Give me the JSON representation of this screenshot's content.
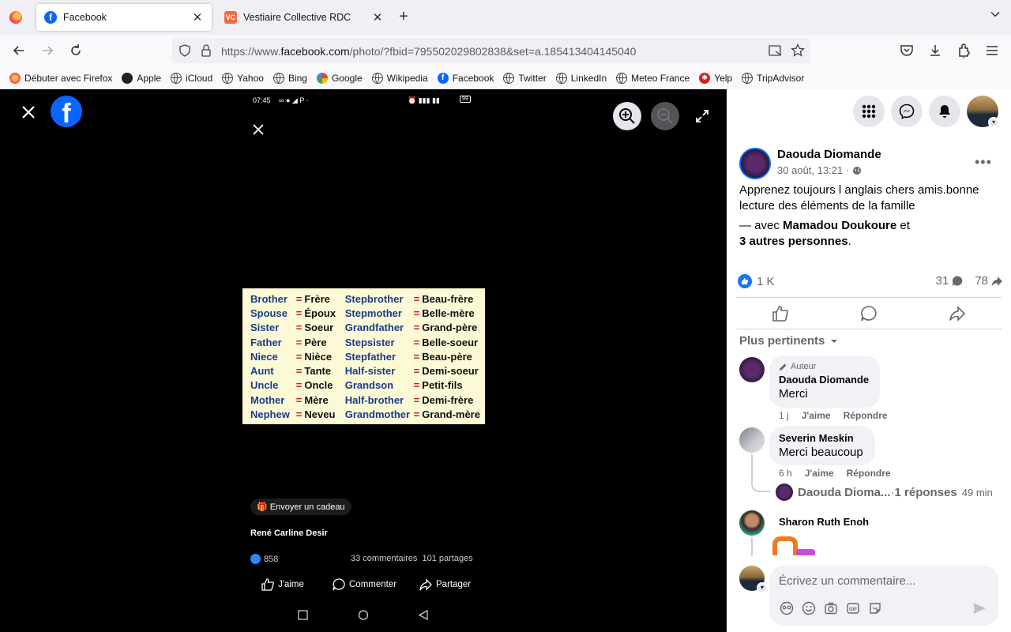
{
  "browser": {
    "tabs": [
      {
        "title": "Facebook",
        "active": true,
        "icon": "facebook-icon"
      },
      {
        "title": "Vestiaire Collective RDC",
        "active": false,
        "icon": "vestiaire-icon"
      }
    ],
    "url_prefix": "https://www.",
    "url_domain": "facebook.com",
    "url_rest": "/photo/?fbid=795502029802838&set=a.185413404145040",
    "bookmarks": [
      {
        "label": "Débuter avec Firefox",
        "icon": "firefox-icon"
      },
      {
        "label": "Apple",
        "icon": "apple-icon"
      },
      {
        "label": "iCloud",
        "icon": "globe-icon"
      },
      {
        "label": "Yahoo",
        "icon": "globe-icon"
      },
      {
        "label": "Bing",
        "icon": "globe-icon"
      },
      {
        "label": "Google",
        "icon": "google-icon"
      },
      {
        "label": "Wikipedia",
        "icon": "globe-icon"
      },
      {
        "label": "Facebook",
        "icon": "facebook-icon"
      },
      {
        "label": "Twitter",
        "icon": "globe-icon"
      },
      {
        "label": "LinkedIn",
        "icon": "globe-icon"
      },
      {
        "label": "Meteo France",
        "icon": "globe-icon"
      },
      {
        "label": "Yelp",
        "icon": "yelp-icon"
      },
      {
        "label": "TripAdvisor",
        "icon": "globe-icon"
      }
    ]
  },
  "photo": {
    "status_time": "07:45",
    "battery": "99",
    "vocab": [
      [
        "Brother",
        "=",
        "Frère",
        "Stepbrother",
        "=",
        "Beau-frère"
      ],
      [
        "Spouse",
        "=",
        "Époux",
        "Stepmother",
        "=",
        "Belle-mère"
      ],
      [
        "Sister",
        "=",
        "Soeur",
        "Grandfather",
        "=",
        "Grand-père"
      ],
      [
        "Father",
        "=",
        "Père",
        "Stepsister",
        "=",
        "Belle-soeur"
      ],
      [
        "Niece",
        "=",
        "Nièce",
        "Stepfather",
        "=",
        "Beau-père"
      ],
      [
        "Aunt",
        "=",
        "Tante",
        "Half-sister",
        "=",
        "Demi-soeur"
      ],
      [
        "Uncle",
        "=",
        "Oncle",
        "Grandson",
        "=",
        "Petit-fils"
      ],
      [
        "Mother",
        "=",
        "Mère",
        "Half-brother",
        "=",
        "Demi-frère"
      ],
      [
        "Nephew",
        "=",
        "Neveu",
        "Grandmother",
        "=",
        "Grand-mère"
      ]
    ],
    "gift_label": "Envoyer un cadeau",
    "author": "René Carline Desir",
    "likes": "858",
    "comments": "33 commentaires",
    "shares": "101 partages",
    "actions": {
      "like": "J'aime",
      "comment": "Commenter",
      "share": "Partager"
    }
  },
  "post": {
    "author": "Daouda Diomande",
    "time": "30 août, 13:21 ·",
    "text": "Apprenez toujours l anglais chers amis.bonne lecture des éléments de la famille",
    "with_prefix": "— avec ",
    "with_name": "Mamadou Doukoure",
    "with_mid": " et",
    "with_others": "3 autres personnes",
    "with_end": ".",
    "reactions": "1 K",
    "comment_count": "31",
    "share_count": "78",
    "sort_label": "Plus pertinents"
  },
  "comments": [
    {
      "author": "Daouda Diomande",
      "text": "Merci",
      "tag": "Auteur",
      "time": "1 j",
      "like": "J'aime",
      "reply": "Répondre"
    },
    {
      "author": "Severin Meskin",
      "text": "Merci beaucoup",
      "time": "6 h",
      "like": "J'aime",
      "reply": "Répondre"
    },
    {
      "author": "Sharon Ruth Enoh"
    }
  ],
  "reply_summary": {
    "name": "Daouda Dioma...",
    "sep": " · ",
    "count": "1 réponses",
    "time": "49 min"
  },
  "composer": {
    "placeholder": "Écrivez un commentaire..."
  },
  "colors": {
    "facebook_blue": "#0866ff",
    "like_blue": "#1877f2",
    "vocab_bg": "#fcf9d6",
    "vocab_en": "#1b3b8a",
    "vocab_eq": "#c8102e"
  }
}
